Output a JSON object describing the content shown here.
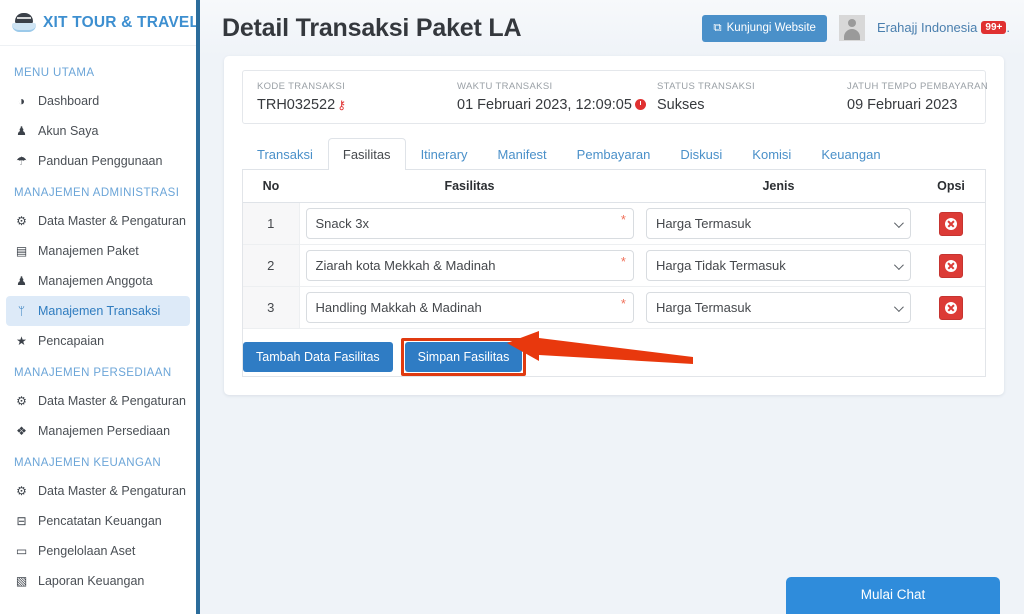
{
  "sidebar": {
    "brand": {
      "name": "XIT TOUR & TRAVEL",
      "logo_icon": "kaaba-logo-icon"
    },
    "sections": [
      {
        "header": "MENU UTAMA",
        "items": [
          {
            "label": "Dashboard",
            "icon": "globe-icon",
            "glyph": "◑",
            "active": false
          },
          {
            "label": "Akun Saya",
            "icon": "user-icon",
            "glyph": "♟",
            "active": false
          },
          {
            "label": "Panduan Penggunaan",
            "icon": "lightbulb-icon",
            "glyph": "⚲",
            "active": false
          }
        ]
      },
      {
        "header": "MANAJEMEN ADMINISTRASI",
        "items": [
          {
            "label": "Data Master & Pengaturan",
            "icon": "gears-icon",
            "glyph": "⚙",
            "active": false
          },
          {
            "label": "Manajemen Paket",
            "icon": "book-icon",
            "glyph": "▤",
            "active": false
          },
          {
            "label": "Manajemen Anggota",
            "icon": "users-icon",
            "glyph": "♟",
            "active": false
          },
          {
            "label": "Manajemen Transaksi",
            "icon": "cart-icon",
            "glyph": "ᛘ",
            "active": true
          },
          {
            "label": "Pencapaian",
            "icon": "star-award-icon",
            "glyph": "★",
            "active": false
          }
        ]
      },
      {
        "header": "MANAJEMEN PERSEDIAAN",
        "items": [
          {
            "label": "Data Master & Pengaturan",
            "icon": "gears-icon",
            "glyph": "⚙",
            "active": false
          },
          {
            "label": "Manajemen Persediaan",
            "icon": "boxes-icon",
            "glyph": "❖",
            "active": false
          }
        ]
      },
      {
        "header": "MANAJEMEN KEUANGAN",
        "items": [
          {
            "label": "Data Master & Pengaturan",
            "icon": "gears-icon",
            "glyph": "⚙",
            "active": false
          },
          {
            "label": "Pencatatan Keuangan",
            "icon": "money-bill-icon",
            "glyph": "⊟",
            "active": false
          },
          {
            "label": "Pengelolaan Aset",
            "icon": "briefcase-icon",
            "glyph": "▭",
            "active": false
          },
          {
            "label": "Laporan Keuangan",
            "icon": "report-icon",
            "glyph": "▧",
            "active": false
          }
        ]
      }
    ]
  },
  "topbar": {
    "page_title": "Detail Transaksi Paket LA",
    "visit_button": "Kunjungi Website",
    "visit_button_icon": "external-link-icon",
    "avatar_icon": "user-avatar-icon",
    "user_name": "Erahajj Indonesia",
    "notification_badge": "99+",
    "trailing_dot": "."
  },
  "info_strip": [
    {
      "label": "KODE TRANSAKSI",
      "value": "TRH032522",
      "icon": "key-icon"
    },
    {
      "label": "WAKTU TRANSAKSI",
      "value": "01 Februari 2023, 12:09:05",
      "icon": "clock-icon"
    },
    {
      "label": "STATUS TRANSAKSI",
      "value": "Sukses",
      "icon": ""
    },
    {
      "label": "JATUH TEMPO PEMBAYARAN",
      "value": "09 Februari 2023",
      "icon": ""
    }
  ],
  "tabs": [
    {
      "label": "Transaksi",
      "active": false
    },
    {
      "label": "Fasilitas",
      "active": true
    },
    {
      "label": "Itinerary",
      "active": false
    },
    {
      "label": "Manifest",
      "active": false
    },
    {
      "label": "Pembayaran",
      "active": false
    },
    {
      "label": "Diskusi",
      "active": false
    },
    {
      "label": "Komisi",
      "active": false
    },
    {
      "label": "Keuangan",
      "active": false
    }
  ],
  "table": {
    "columns": [
      "No",
      "Fasilitas",
      "Jenis",
      "Opsi"
    ],
    "jenis_options": [
      "Harga Termasuk",
      "Harga Tidak Termasuk"
    ],
    "required_marker": "*",
    "delete_icon": "circle-x-icon",
    "rows": [
      {
        "no": "1",
        "fasilitas": "Snack 3x",
        "jenis": "Harga Termasuk"
      },
      {
        "no": "2",
        "fasilitas": "Ziarah kota Mekkah & Madinah",
        "jenis": "Harga Tidak Termasuk"
      },
      {
        "no": "3",
        "fasilitas": "Handling Makkah & Madinah",
        "jenis": "Harga Termasuk"
      }
    ]
  },
  "actions": {
    "add_label": "Tambah Data Fasilitas",
    "save_label": "Simpan Fasilitas"
  },
  "chat": {
    "label": "Mulai Chat"
  },
  "colors": {
    "brand_blue": "#3d8fd0",
    "primary_button": "#2f7cc4",
    "danger": "#dc3b36",
    "annotation": "#e03a10",
    "page_bg": "#eff3f8",
    "sidebar_border": "#2b6c9b"
  }
}
